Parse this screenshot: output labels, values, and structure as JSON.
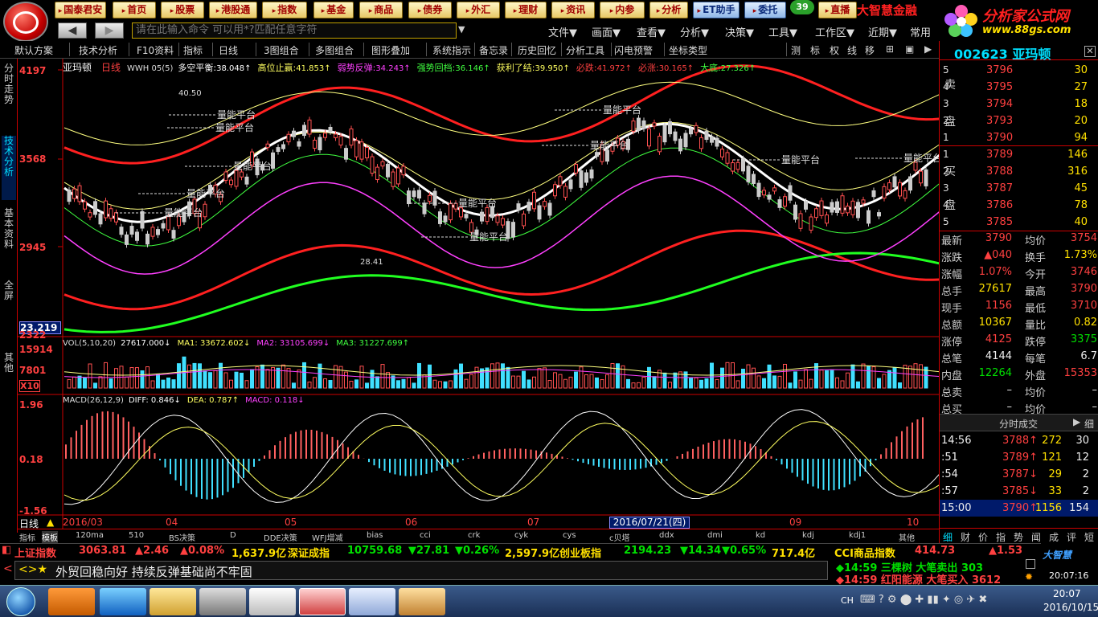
{
  "nav": [
    "国泰君安",
    "首页",
    "股票",
    "港股通",
    "指数",
    "基金",
    "商品",
    "债券",
    "外汇",
    "理财",
    "资讯",
    "内参",
    "分析",
    "ET助手",
    "委托",
    "直播"
  ],
  "badge": "39",
  "brand": "大智慧金融",
  "site": {
    "t1": "分析家公式网",
    "t2": "www.88gs.com"
  },
  "command": {
    "placeholder": "请在此输入命令   可以用*?匹配任意字符"
  },
  "menus": [
    "文件▼",
    "画面▼",
    "查看▼",
    "分析▼",
    "决策▼",
    "工具▼",
    "工作区▼",
    "近期▼",
    "常用"
  ],
  "toolbar": [
    "默认方案",
    "技术分析",
    "F10资料",
    "指标",
    "日线",
    "3图组合",
    "多图组合",
    "图形叠加",
    "系统指示",
    "备忘录",
    "历史回忆",
    "分析工具",
    "闪电预警",
    "坐标类型",
    "测",
    "标",
    "权",
    "线",
    "移"
  ],
  "sidetabs": [
    "分时走势",
    "技术分析",
    "基本资料",
    "全屏",
    "其他"
  ],
  "chart": {
    "stock": "亚玛顿",
    "period": "日线",
    "indicator": "WWH 05(5)",
    "info": [
      {
        "k": "多空平衡:",
        "v": "38.048↑",
        "c": "#ffffff"
      },
      {
        "k": "高位止赢:",
        "v": "41.853↑",
        "c": "#ffff60"
      },
      {
        "k": "弱势反弹:",
        "v": "34.243↑",
        "c": "#ff40ff"
      },
      {
        "k": "强势回档:",
        "v": "36.146↑",
        "c": "#40ff40"
      },
      {
        "k": "获利了结:",
        "v": "39.950↑",
        "c": "#ffff60"
      },
      {
        "k": "必跌:",
        "v": "41.972↑",
        "c": "#ff4040"
      },
      {
        "k": "必涨:",
        "v": "30.165↑",
        "c": "#ff4040"
      },
      {
        "k": "大底:",
        "v": "27.326↑",
        "c": "#40ff40"
      }
    ],
    "yLabels": [
      "4197",
      "3568",
      "2945",
      "23.219",
      "2322"
    ],
    "annot": [
      "40.50",
      "28.41"
    ],
    "platform": "量能平台",
    "vol": {
      "name": "VOL(5,10,20)",
      "v": "27617.000↓",
      "ma1": "MA1: 33672.602↓",
      "ma2": "MA2: 33105.699↓",
      "ma3": "MA3: 31227.699↑",
      "y": [
        "15914",
        "7801",
        "X10"
      ]
    },
    "macd": {
      "name": "MACD(26,12,9)",
      "diff": "DIFF: 0.846↓",
      "dea": "DEA: 0.787↑",
      "macd": "MACD: 0.118↓",
      "y": [
        "1.96",
        "0.18",
        "-1.56"
      ]
    },
    "x": [
      "2016/03",
      "04",
      "05",
      "06",
      "07",
      "08",
      "09",
      "10"
    ],
    "cursor_date": "2016/07/21(四)",
    "period_label": "日线"
  },
  "bottomtabs": [
    "指标",
    "模板",
    "120ma",
    "510",
    "BS决策",
    "D",
    "DDE决策",
    "WFJ增减",
    "bias",
    "cci",
    "crk",
    "cyk",
    "cys",
    "c贝塔",
    "ddx",
    "dmi",
    "kd",
    "kdj",
    "kdj1",
    "其他"
  ],
  "quote": {
    "code": "002623",
    "name": "亚玛顿",
    "sell": [
      {
        "l": "5",
        "p": "3796",
        "v": "30"
      },
      {
        "l": "4",
        "p": "3795",
        "v": "27"
      },
      {
        "l": "3",
        "p": "3794",
        "v": "18"
      },
      {
        "l": "2",
        "p": "3793",
        "v": "20"
      },
      {
        "l": "1",
        "p": "3790",
        "v": "94"
      }
    ],
    "buy": [
      {
        "l": "1",
        "p": "3789",
        "v": "146"
      },
      {
        "l": "2",
        "p": "3788",
        "v": "316"
      },
      {
        "l": "3",
        "p": "3787",
        "v": "45"
      },
      {
        "l": "4",
        "p": "3786",
        "v": "78"
      },
      {
        "l": "5",
        "p": "3785",
        "v": "40"
      }
    ],
    "sellLabel": [
      "卖",
      "盘"
    ],
    "buyLabel": [
      "买",
      "盘"
    ],
    "rows": [
      {
        "k1": "最新",
        "v1": "3790",
        "c1": "red",
        "k2": "均价",
        "v2": "3754",
        "c2": "red"
      },
      {
        "k1": "涨跌",
        "v1": "▲040",
        "c1": "red",
        "k2": "换手",
        "v2": "1.73%",
        "c2": "yel"
      },
      {
        "k1": "涨幅",
        "v1": "1.07%",
        "c1": "red",
        "k2": "今开",
        "v2": "3746",
        "c2": "red"
      },
      {
        "k1": "总手",
        "v1": "27617",
        "c1": "yel",
        "k2": "最高",
        "v2": "3790",
        "c2": "red"
      },
      {
        "k1": "现手",
        "v1": "1156",
        "c1": "red",
        "k2": "最低",
        "v2": "3710",
        "c2": "red"
      },
      {
        "k1": "总额",
        "v1": "10367",
        "c1": "yel",
        "k2": "量比",
        "v2": "0.82",
        "c2": "yel"
      },
      {
        "k1": "涨停",
        "v1": "4125",
        "c1": "red",
        "k2": "跌停",
        "v2": "3375",
        "c2": "grn"
      },
      {
        "k1": "总笔",
        "v1": "4144",
        "c1": "wht",
        "k2": "每笔",
        "v2": "6.7",
        "c2": "wht"
      },
      {
        "k1": "内盘",
        "v1": "12264",
        "c1": "grn",
        "k2": "外盘",
        "v2": "15353",
        "c2": "red"
      },
      {
        "k1": "总卖",
        "v1": "–",
        "c1": "wht",
        "k2": "均价",
        "v2": "–",
        "c2": "wht"
      },
      {
        "k1": "总买",
        "v1": "–",
        "c1": "wht",
        "k2": "均价",
        "v2": "–",
        "c2": "wht"
      }
    ],
    "tickTitle": "分时成交",
    "ticks": [
      {
        "t": "14:56",
        "p": "3788↑",
        "pc": "red",
        "v": "272",
        "n": "30"
      },
      {
        "t": ":51",
        "p": "3789↑",
        "pc": "red",
        "v": "121",
        "n": "12"
      },
      {
        "t": ":54",
        "p": "3787↓",
        "pc": "red",
        "v": "29",
        "n": "2"
      },
      {
        "t": ":57",
        "p": "3785↓",
        "pc": "red",
        "v": "33",
        "n": "2"
      },
      {
        "t": "15:00",
        "p": "3790↑",
        "pc": "red",
        "v": "1156",
        "n": "154"
      }
    ],
    "rtabs": [
      "细",
      "财",
      "价",
      "指",
      "势",
      "闻",
      "成",
      "评",
      "短"
    ]
  },
  "indices": [
    {
      "t": "上证指数",
      "c": "#ff4040"
    },
    {
      "t": "3063.81",
      "c": "#ff4040"
    },
    {
      "t": "▲2.46",
      "c": "#ff4040"
    },
    {
      "t": "▲0.08%",
      "c": "#ff4040"
    },
    {
      "t": "1,637.9亿",
      "c": "#ffe000"
    },
    {
      "t": "深证成指",
      "c": "#ffe000"
    },
    {
      "t": "10759.68",
      "c": "#00e000"
    },
    {
      "t": "▼27.81",
      "c": "#00e000"
    },
    {
      "t": "▼0.26%",
      "c": "#00e000"
    },
    {
      "t": "2,597.9亿",
      "c": "#ffe000"
    },
    {
      "t": "创业板指",
      "c": "#ffe000"
    },
    {
      "t": "2194.23",
      "c": "#00e000"
    },
    {
      "t": "▼14.34",
      "c": "#00e000"
    },
    {
      "t": "▼0.65%",
      "c": "#00e000"
    },
    {
      "t": "717.4亿",
      "c": "#ffe000"
    },
    {
      "t": "CCI商品指数",
      "c": "#ffe000"
    },
    {
      "t": "414.73",
      "c": "#ff4040"
    },
    {
      "t": "▲1.53",
      "c": "#ff4040"
    }
  ],
  "news": {
    "text": "外贸回稳向好 持续反弹基础尚不牢固",
    "alert1": "◆14:59 三棵树  大笔卖出 303",
    "alert2": "◆14:59 红阳能源 大笔买入 3612",
    "logo": "大智慧",
    "time": "20:07:16"
  },
  "taskbar": {
    "lang": "CH",
    "time": "20:07",
    "date": "2016/10/15"
  }
}
